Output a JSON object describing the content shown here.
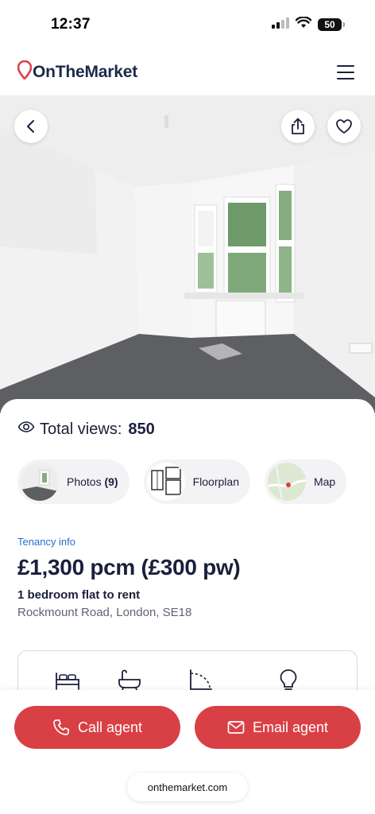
{
  "status_bar": {
    "time": "12:37",
    "battery": "50",
    "icons": [
      "signal-icon",
      "wifi-icon",
      "battery-icon"
    ]
  },
  "header": {
    "logo_text": "OnTheMarket",
    "menu_icon": "hamburger-menu-icon"
  },
  "hero": {
    "back_icon": "chevron-left-icon",
    "share_icon": "share-icon",
    "favourite_icon": "heart-icon"
  },
  "stats": {
    "views_label": "Total views:",
    "views_count": "850",
    "icon": "eye-icon"
  },
  "media": {
    "photos_label": "Photos",
    "photos_count": "(9)",
    "floorplan_label": "Floorplan",
    "map_label": "Map"
  },
  "listing": {
    "tenancy_link": "Tenancy info",
    "price": "£1,300 pcm (£300 pw)",
    "title": "1 bedroom flat to rent",
    "address": "Rockmount Road, London, SE18"
  },
  "features": {
    "icons": [
      "bed-icon",
      "bath-icon",
      "floor-area-icon",
      "lightbulb-icon"
    ]
  },
  "actions": {
    "call_label": "Call agent",
    "email_label": "Email agent",
    "site_url": "onthemarket.com"
  },
  "colors": {
    "brand_red": "#d94046",
    "link_blue": "#2a6fcf",
    "text_dark": "#1b1f3b"
  }
}
